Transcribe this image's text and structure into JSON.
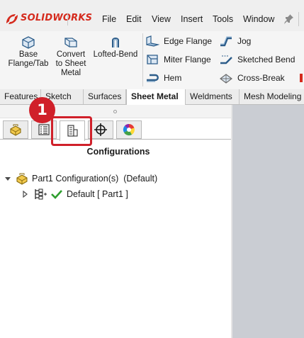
{
  "app": {
    "logo_text": "SOLIDWORKS"
  },
  "menu": {
    "items": [
      "File",
      "Edit",
      "View",
      "Insert",
      "Tools",
      "Window"
    ]
  },
  "ribbon": {
    "large_buttons": [
      {
        "label_lines": [
          "Base",
          "Flange/Tab"
        ],
        "icon": "base-flange-icon"
      },
      {
        "label_lines": [
          "Convert",
          "to Sheet",
          "Metal"
        ],
        "icon": "convert-to-sheet-metal-icon"
      },
      {
        "label_lines": [
          "Lofted-Bend"
        ],
        "icon": "lofted-bend-icon"
      }
    ],
    "small_buttons": [
      {
        "label": "Edge Flange",
        "icon": "edge-flange-icon"
      },
      {
        "label": "Miter Flange",
        "icon": "miter-flange-icon"
      },
      {
        "label": "Hem",
        "icon": "hem-icon"
      },
      {
        "label": "Jog",
        "icon": "jog-icon"
      },
      {
        "label": "Sketched Bend",
        "icon": "sketched-bend-icon"
      },
      {
        "label": "Cross-Break",
        "icon": "cross-break-icon"
      }
    ]
  },
  "tabs": {
    "items": [
      "Features",
      "Sketch",
      "Surfaces",
      "Sheet Metal",
      "Weldments",
      "Mesh Modeling"
    ],
    "active": "Sheet Metal"
  },
  "pane": {
    "manager_tabs": [
      {
        "icon": "feature-manager-icon"
      },
      {
        "icon": "property-manager-icon"
      },
      {
        "icon": "configuration-manager-icon",
        "active": true
      },
      {
        "icon": "dimxpert-manager-icon"
      },
      {
        "icon": "display-manager-icon"
      }
    ],
    "step_badge": "1",
    "title": "Configurations",
    "tree": {
      "root_label": "Part1 Configuration(s)  (Default)",
      "child_label": "Default [ Part1 ]"
    }
  },
  "colors": {
    "brand": "#d52b1e",
    "highlight": "#d0202a",
    "graphics_area": "#cacdd3",
    "active_check": "#2e9e2e"
  }
}
